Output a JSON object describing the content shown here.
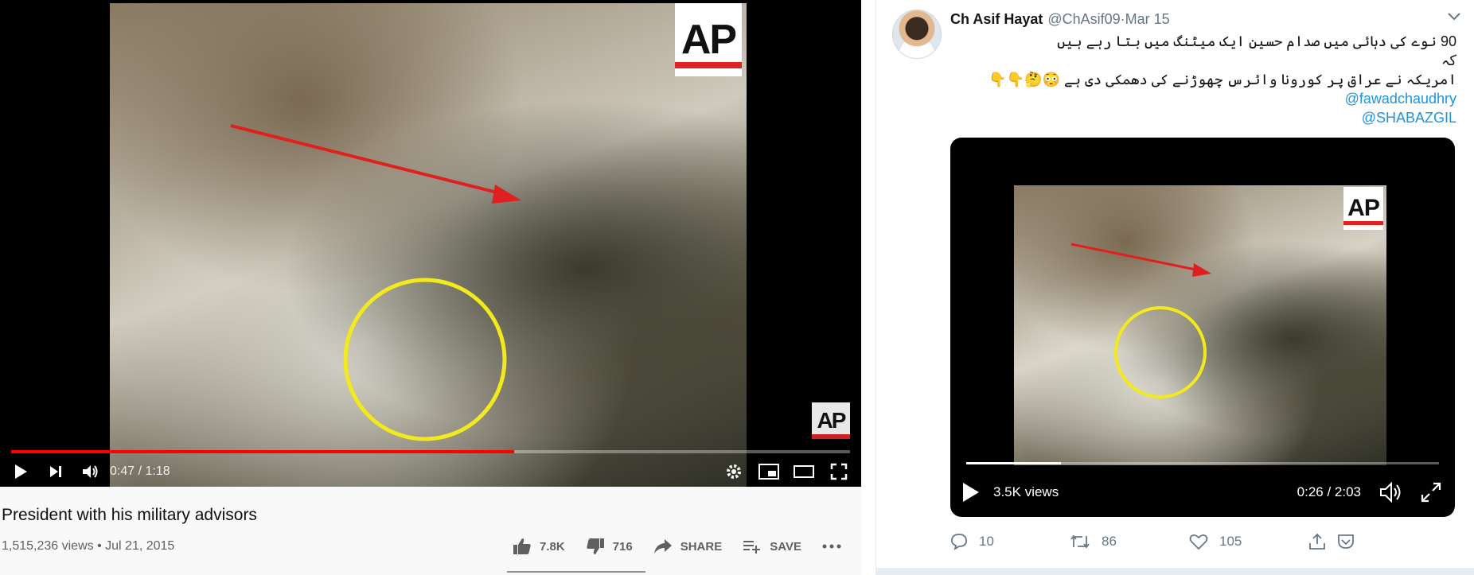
{
  "youtube": {
    "player": {
      "current_time": "0:47",
      "separator": " / ",
      "duration": "1:18",
      "progress_fraction": 0.6,
      "watermark": "AP"
    },
    "title": "President with his military advisors",
    "views": "1,515,236 views",
    "dot": " • ",
    "date": "Jul 21, 2015",
    "actions": {
      "likes": "7.8K",
      "dislikes": "716",
      "share": "SHARE",
      "save": "SAVE"
    }
  },
  "tweet": {
    "name": "Ch Asif Hayat",
    "handle": "@ChAsif09",
    "sep": " · ",
    "date": "Mar 15",
    "text_line1": "90 نوے کی دہائی میں صدام حسین ایک میٹنگ میں بتا رہے ہیں",
    "text_line2": "کہ",
    "text_line3": "امریکہ نے عراق پر کورونا وائرس چھوڑنے کی دھمکی دی ہے 😳🤔👇👇",
    "mention1": "@fawadchaudhry",
    "mention2": "@SHABAZGIL",
    "video": {
      "views": "3.5K views",
      "current_time": "0:26",
      "separator": " / ",
      "duration": "2:03",
      "progress_fraction": 0.2,
      "watermark": "AP"
    },
    "actions": {
      "replies": "10",
      "retweets": "86",
      "likes": "105"
    }
  },
  "colors": {
    "youtube_red": "#ff0000",
    "twitter_blue": "#1b95e0",
    "annotation_arrow": "#e02020",
    "annotation_circle": "#f2ea1c"
  }
}
